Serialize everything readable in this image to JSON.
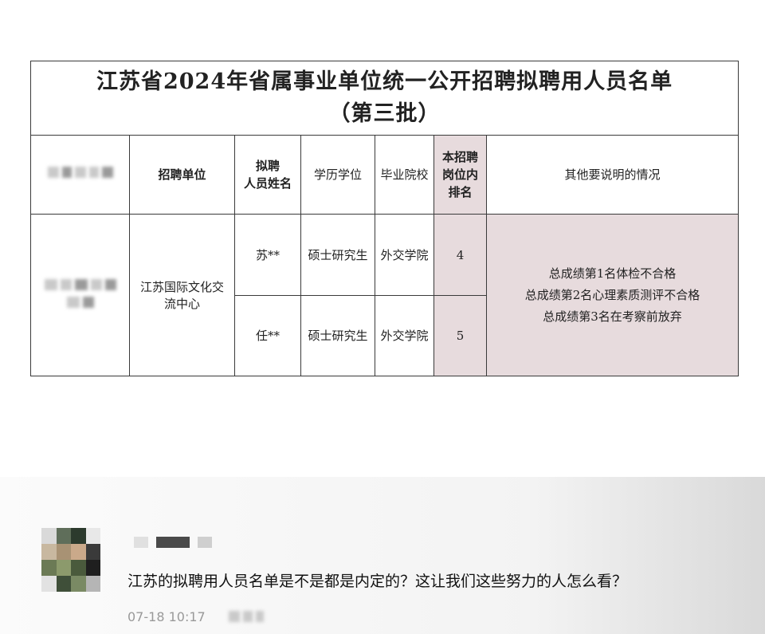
{
  "document": {
    "title": "江苏省2024年省属事业单位统一公开招聘拟聘用人员名单",
    "subtitle": "（第三批）",
    "headers": {
      "unit": "招聘单位",
      "name_l1": "拟聘",
      "name_l2": "人员姓名",
      "degree": "学历学位",
      "school": "毕业院校",
      "rank_l1": "本招聘",
      "rank_l2": "岗位内",
      "rank_l3": "排名",
      "notes": "其他要说明的情况"
    },
    "unit_l1": "江苏国际文化交",
    "unit_l2": "流中心",
    "rows": [
      {
        "name": "苏**",
        "degree": "硕士研究生",
        "school": "外交学院",
        "rank": "4"
      },
      {
        "name": "任**",
        "degree": "硕士研究生",
        "school": "外交学院",
        "rank": "5"
      }
    ],
    "notes": [
      "总成绩第1名体检不合格",
      "总成绩第2名心理素质测评不合格",
      "总成绩第3名在考察前放弃"
    ],
    "highlight_color": "#e7dbdd"
  },
  "comment": {
    "text": "江苏的拟聘用人员名单是不是都是内定的？这让我们这些努力的人怎么看？",
    "time": "07-18 10:17"
  }
}
